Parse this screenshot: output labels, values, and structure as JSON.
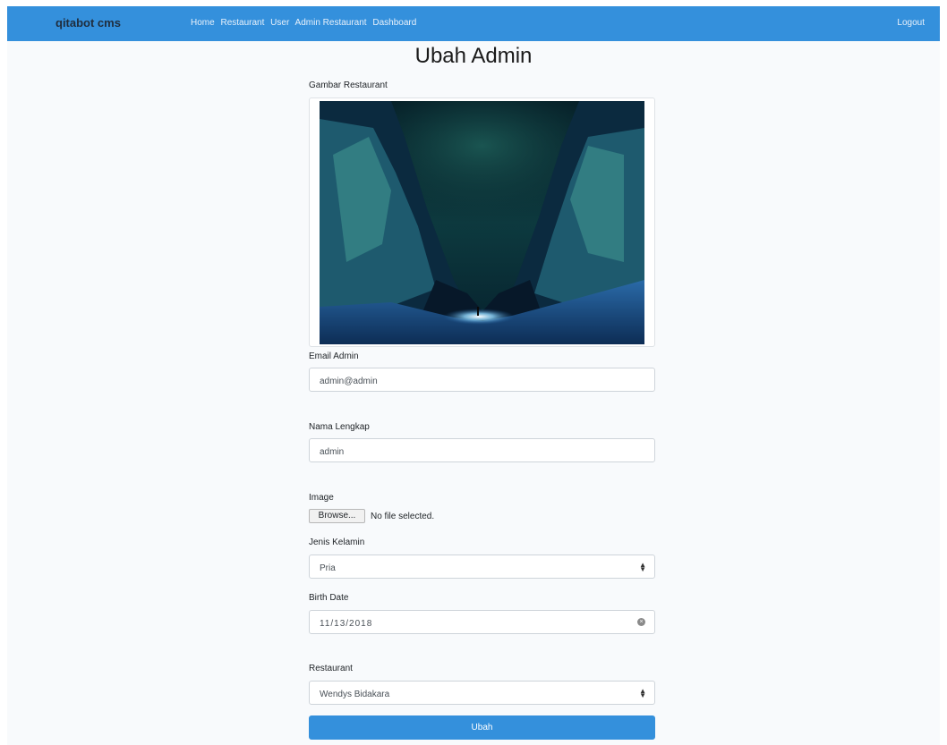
{
  "navbar": {
    "brand": "qitabot cms",
    "links": [
      "Home",
      "Restaurant",
      "User",
      "Admin Restaurant",
      "Dashboard"
    ],
    "logout": "Logout"
  },
  "page_title": "Ubah Admin",
  "form": {
    "image_label": "Gambar Restaurant",
    "email_label": "Email Admin",
    "email_value": "admin@admin",
    "name_label": "Nama Lengkap",
    "name_value": "admin",
    "file_label": "Image",
    "browse_label": "Browse...",
    "file_status": "No file selected.",
    "gender_label": "Jenis Kelamin",
    "gender_value": "Pria",
    "birth_label": "Birth Date",
    "birth_value": "11/13/2018",
    "restaurant_label": "Restaurant",
    "restaurant_value": "Wendys Bidakara",
    "submit_label": "Ubah"
  },
  "colors": {
    "primary": "#3490dc",
    "background": "#f8fafc"
  },
  "icons": {
    "select_arrow": "updown-chevron-icon",
    "clear": "clear-circle-icon"
  }
}
